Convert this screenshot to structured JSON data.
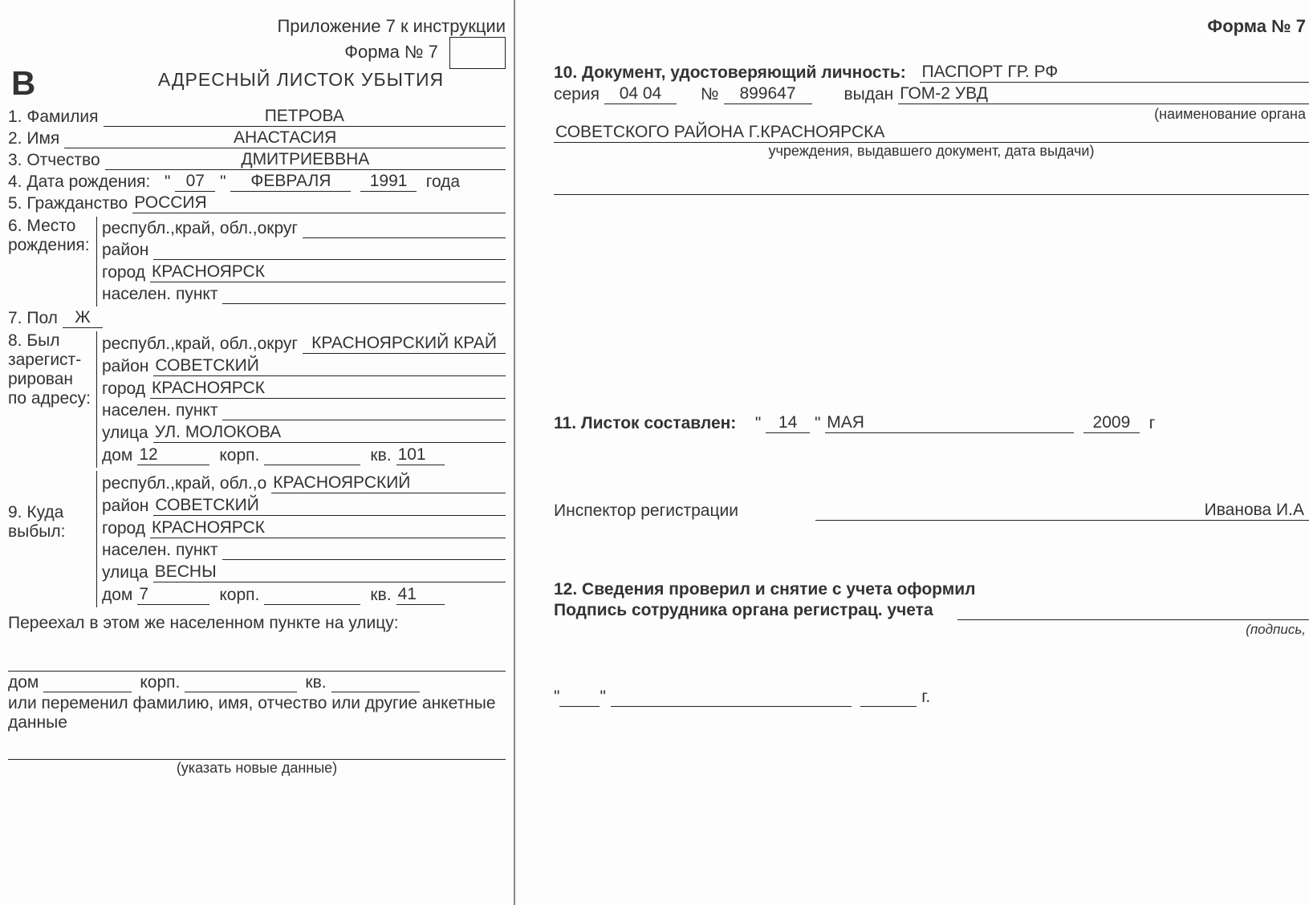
{
  "header": {
    "attachment": "Приложение 7 к инструкции",
    "form_no_label": "Форма № 7",
    "form_no_right": "Форма № 7",
    "letter": "В",
    "title": "АДРЕСНЫЙ ЛИСТОК УБЫТИЯ"
  },
  "f1": {
    "label": "1. Фамилия",
    "value": "ПЕТРОВА"
  },
  "f2": {
    "label": "2. Имя",
    "value": "АНАСТАСИЯ"
  },
  "f3": {
    "label": "3. Отчество",
    "value": "ДМИТРИЕВВНА"
  },
  "f4": {
    "label": "4. Дата рождения:",
    "day": "07",
    "month": "ФЕВРАЛЯ",
    "year": "1991",
    "year_suffix": "года"
  },
  "f5": {
    "label": "5. Гражданство",
    "value": "РОССИЯ"
  },
  "f6": {
    "label": "6. Место рожде­ния:",
    "l_region": "республ.,край, обл.,округ",
    "region": "",
    "l_raion": "район",
    "raion": "",
    "l_city": "город",
    "city": "КРАСНОЯРСК",
    "l_punkt": "населен. пункт",
    "punkt": ""
  },
  "f7": {
    "label": "7. Пол",
    "value": "Ж"
  },
  "f8": {
    "label": "8. Был зарегист­рирован по адресу:",
    "l_region": "республ.,край, обл.,округ",
    "region": "КРАСНОЯРСКИЙ КРАЙ",
    "l_raion": "район",
    "raion": "СОВЕТСКИЙ",
    "l_city": "город",
    "city": "КРАСНОЯРСК",
    "l_punkt": "населен. пункт",
    "punkt": "",
    "l_street": "улица",
    "street": "УЛ. МОЛОКОВА",
    "l_dom": "дом",
    "dom": "12",
    "l_korp": "корп.",
    "korp": "",
    "l_kv": "кв.",
    "kv": "101"
  },
  "f9": {
    "label": "9. Куда выбыл:",
    "l_region": "республ.,край, обл.,о",
    "region": "КРАСНОЯРСКИЙ",
    "l_raion": "район",
    "raion": "СОВЕТСКИЙ",
    "l_city": "город",
    "city": "КРАСНОЯРСК",
    "l_punkt": "населен. пункт",
    "punkt": "",
    "l_street": "улица",
    "street": "ВЕСНЫ",
    "l_dom": "дом",
    "dom": "7",
    "l_korp": "корп.",
    "korp": "",
    "l_kv": "кв.",
    "kv": "41"
  },
  "moved": {
    "line1": "Переехал в этом же населенном пункте на улицу:",
    "l_dom": "дом",
    "dom": "",
    "l_korp": "корп.",
    "korp": "",
    "l_kv": "кв.",
    "kv": "",
    "line2": "или переменил фамилию, имя, отчество или другие анкетные данные",
    "hint": "(указать новые данные)"
  },
  "f10": {
    "label": "10. Документ, удостоверяющий личность:",
    "doc": "ПАСПОРТ ГР. РФ",
    "l_series": "серия",
    "series": "04 04",
    "l_no": "№",
    "no": "899647",
    "l_issued": "выдан",
    "issued1": "ГОМ-2 УВД",
    "hint1": "(наименование органа",
    "issued2": "СОВЕТСКОГО РАЙОНА Г.КРАСНОЯРСКА",
    "hint2": "учреждения, выдавшего документ, дата выдачи)"
  },
  "f11": {
    "label": "11. Листок составлен:",
    "day": "14",
    "month": "МАЯ",
    "year": "2009",
    "year_suffix": "г"
  },
  "inspector": {
    "label": "Инспектор регистрации",
    "name": "Иванова И.А"
  },
  "f12": {
    "line1": "12. Сведения проверил и снятие с учета оформил",
    "line2": "Подпись сотрудника органа регистрац. учета",
    "hint": "(подпись,",
    "year_suffix": "г."
  }
}
